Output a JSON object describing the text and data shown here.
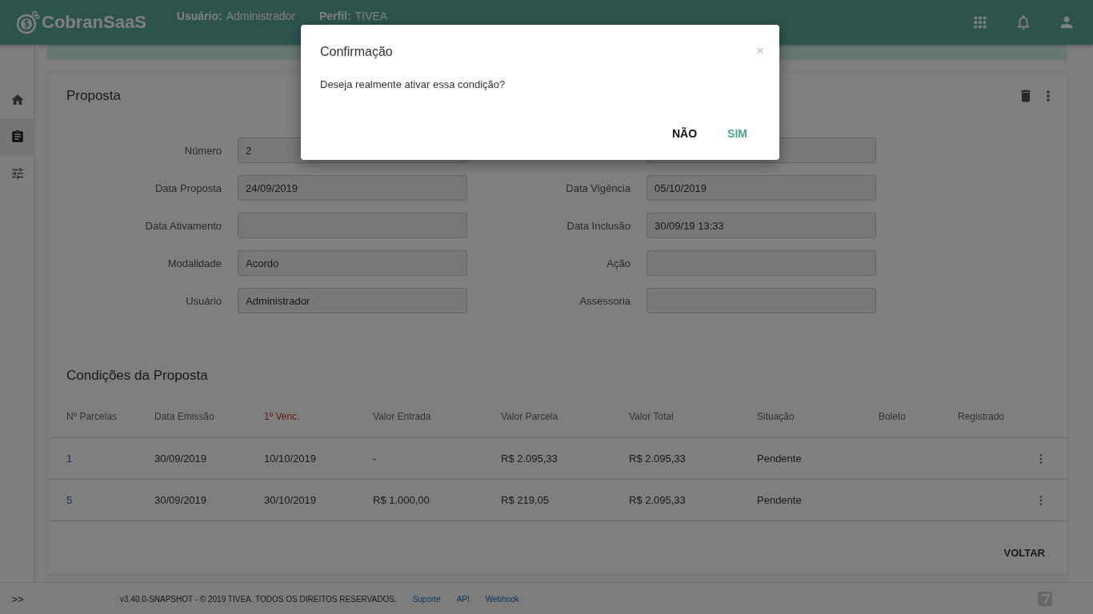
{
  "header": {
    "brand": "CobranSaaS",
    "user_label": "Usuário:",
    "user": "Administrador",
    "profile_label": "Perfil:",
    "profile": "TIVEA"
  },
  "sidebar": {
    "items": [
      {
        "kind": "home",
        "selected": false
      },
      {
        "kind": "clipboard",
        "selected": true
      },
      {
        "kind": "tune",
        "selected": false
      }
    ],
    "expand": ">>"
  },
  "card": {
    "title": "Proposta",
    "field_rows": [
      [
        {
          "label": "Número",
          "value": "2"
        }
      ],
      [
        {
          "label": "Data Proposta",
          "value": "24/09/2019"
        },
        {
          "label": "Data Vigência",
          "value": "05/10/2019"
        }
      ],
      [
        {
          "label": "Data Ativamento"
        },
        {
          "label": "Data Inclusão",
          "value": "30/09/19 13:33"
        }
      ],
      [
        {
          "label": "Modalidade",
          "value": "Acordo"
        },
        {
          "label": "Ação"
        }
      ],
      [
        {
          "label": "Usuário",
          "value": "Administrador"
        },
        {
          "label": "Assessoria"
        }
      ]
    ],
    "conditions_title": "Condições da Proposta",
    "table": {
      "columns": [
        {
          "label": "Nº Parcelas",
          "highlight": false
        },
        {
          "label": "Data Emissão",
          "highlight": false
        },
        {
          "label": "1º Venc.",
          "highlight": true
        },
        {
          "label": "Valor Entrada",
          "highlight": false
        },
        {
          "label": "Valor Parcela",
          "highlight": false
        },
        {
          "label": "Valor Total",
          "highlight": false
        },
        {
          "label": "Situação",
          "highlight": false
        },
        {
          "label": "Boleto",
          "highlight": false
        },
        {
          "label": "Registrado",
          "highlight": false
        }
      ],
      "rows": [
        [
          "1",
          "30/09/2019",
          "10/10/2019",
          "-",
          "R$ 2.095,33",
          "R$ 2.095,33",
          "Pendente"
        ],
        [
          "5",
          "30/09/2019",
          "30/10/2019",
          "R$ 1.000,00",
          "R$ 219,05",
          "R$ 2.095,33",
          "Pendente"
        ]
      ]
    },
    "back_button": "VOLTAR"
  },
  "footer": {
    "text": "v3.40.0-SNAPSHOT - © 2019 TIVEA. TODOS OS DIREITOS RESERVADOS.",
    "links": [
      "Suporte",
      "API",
      "Webhook"
    ]
  },
  "dialog": {
    "title": "Confirmação",
    "close": "×",
    "message": "Deseja realmente ativar essa condição?",
    "buttons": [
      {
        "label": "NÃO",
        "primary": false
      },
      {
        "label": "SIM",
        "primary": true
      }
    ]
  }
}
